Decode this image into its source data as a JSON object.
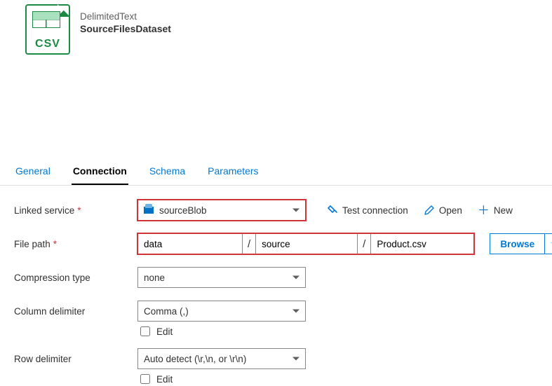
{
  "header": {
    "type_label": "DelimitedText",
    "dataset_name": "SourceFilesDataset",
    "badge_text": "CSV"
  },
  "tabs": {
    "general": "General",
    "connection": "Connection",
    "schema": "Schema",
    "parameters": "Parameters"
  },
  "labels": {
    "linked_service": "Linked service",
    "file_path": "File path",
    "compression_type": "Compression type",
    "column_delimiter": "Column delimiter",
    "row_delimiter": "Row delimiter",
    "edit": "Edit"
  },
  "linked_service": {
    "value": "sourceBlob",
    "actions": {
      "test": "Test connection",
      "open": "Open",
      "new": "New"
    }
  },
  "file_path": {
    "container": "data",
    "directory": "source",
    "file": "Product.csv",
    "browse": "Browse"
  },
  "compression": {
    "value": "none"
  },
  "column_delim": {
    "value": "Comma (,)"
  },
  "row_delim": {
    "value": "Auto detect (\\r,\\n, or \\r\\n)"
  }
}
